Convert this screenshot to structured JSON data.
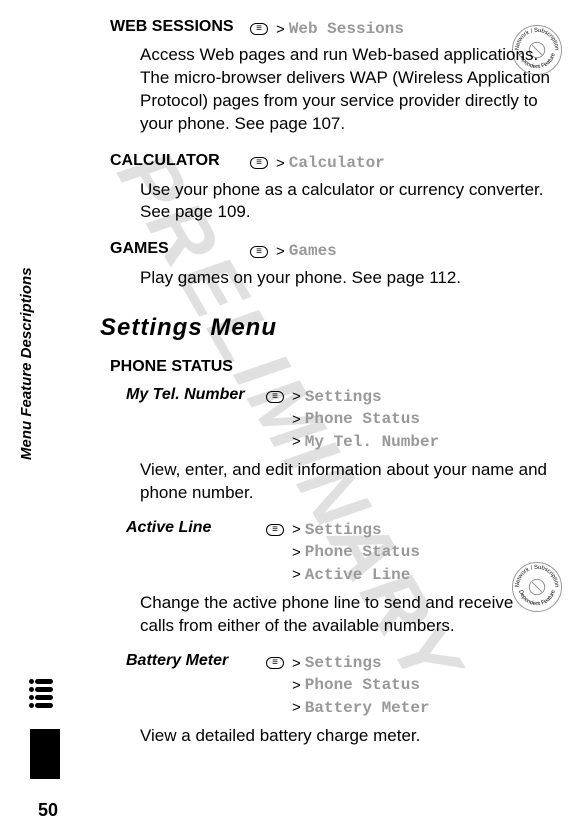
{
  "watermark": "PRELIMINARY",
  "side_label": "Menu Feature Descriptions",
  "page_number": "50",
  "badge_text": "Network / Subscription Dependent Feature",
  "features": {
    "web_sessions": {
      "title": "WEB SESSIONS",
      "path": "Web Sessions",
      "desc": "Access Web pages and run Web-based applications. The micro-browser delivers WAP (Wireless Application Protocol) pages from your service provider directly to your phone. See page 107."
    },
    "calculator": {
      "title": "CALCULATOR",
      "path": "Calculator",
      "desc": "Use your phone as a calculator or currency converter. See page 109."
    },
    "games": {
      "title": "GAMES",
      "path": "Games",
      "desc": "Play games on your phone. See page 112."
    }
  },
  "section_heading": "Settings Menu",
  "subsection": "PHONE STATUS",
  "settings_label": "Settings",
  "phone_status_label": "Phone Status",
  "sub_features": {
    "mytel": {
      "title": "My Tel. Number",
      "path": "My Tel. Number",
      "desc": "View, enter, and edit information about your name and phone number."
    },
    "active_line": {
      "title": "Active Line",
      "path": "Active Line",
      "desc": "Change the active phone line to send and receive calls from either of the available numbers."
    },
    "battery": {
      "title": "Battery Meter",
      "path": "Battery Meter",
      "desc": "View a detailed battery charge meter."
    }
  },
  "arrow": ">"
}
